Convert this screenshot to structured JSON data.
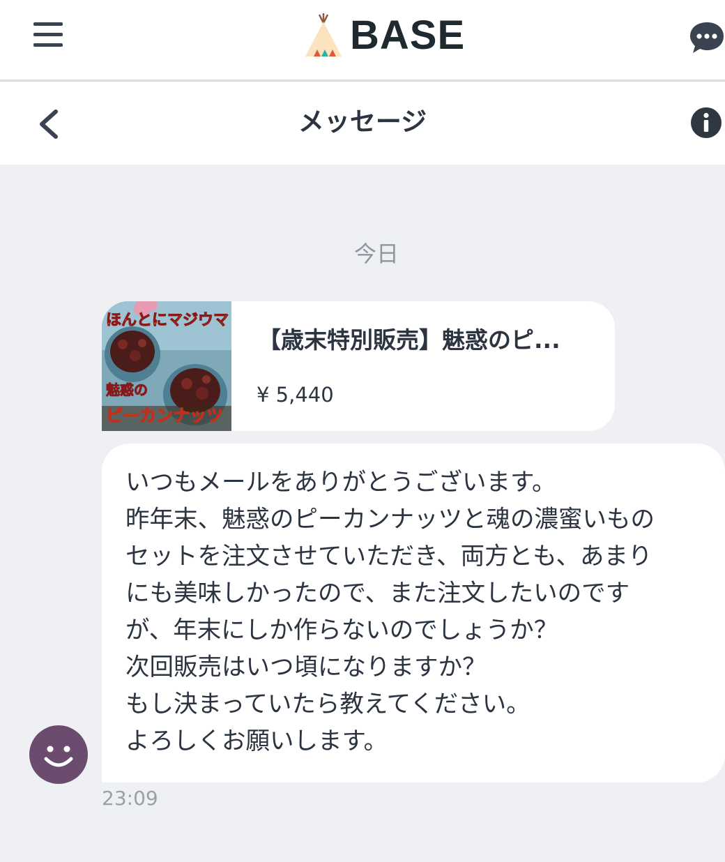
{
  "app": {
    "brand": "BASE"
  },
  "header": {
    "title": "メッセージ"
  },
  "conversation": {
    "day_label": "今日",
    "product": {
      "title": "【歳末特別販売】魅惑のピ...",
      "price": "¥ 5,440",
      "thumbnail_text": [
        "ほんとにマジウマ",
        "魅惑の",
        "ピーカンナッツ"
      ]
    },
    "message": {
      "lines": [
        "いつもメールをありがとうございます。",
        "昨年末、魅惑のピーカンナッツと魂の濃蜜いもの",
        "セットを注文させていただき、両方とも、あまり",
        "にも美味しかったので、また注文したいのです",
        "が、年末にしか作らないのでしょうか？",
        "次回販売はいつ頃になりますか？",
        "もし決まっていたら教えてください。",
        "よろしくお願いします。"
      ],
      "time": "23:09"
    }
  },
  "icons": {
    "menu": "hamburger-icon",
    "chat": "chat-bubble-icon",
    "back": "chevron-left-icon",
    "info": "info-icon",
    "avatar": "smiley-avatar-icon"
  },
  "colors": {
    "background": "#eef0f4",
    "text": "#2b3440",
    "avatar": "#6b4b6e",
    "icon_dark": "#3a4450"
  }
}
